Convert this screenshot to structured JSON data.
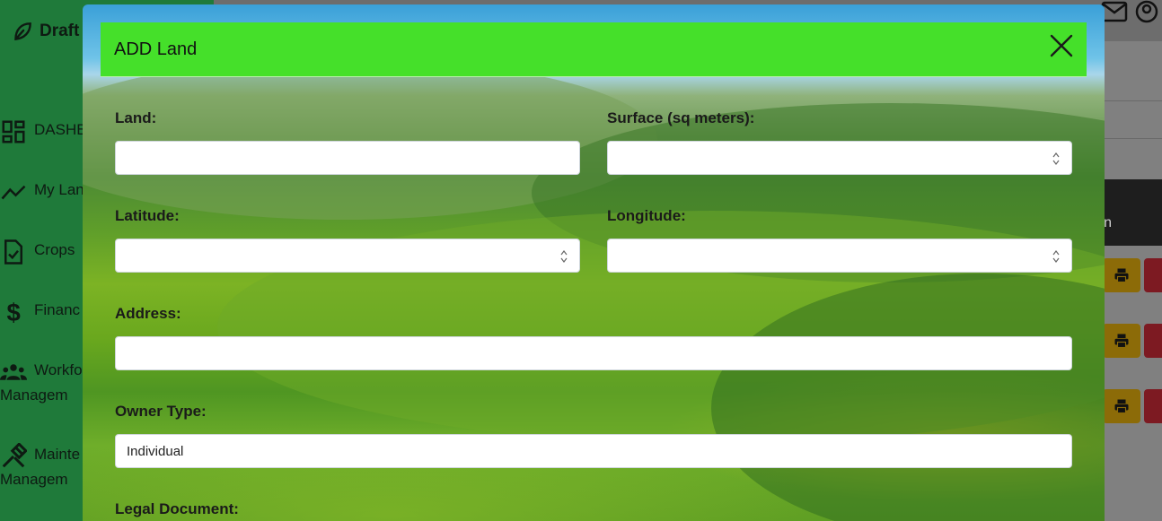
{
  "app": {
    "brand": "Draft",
    "nav": [
      {
        "label": "DASHB",
        "icon": "dashboard-icon"
      },
      {
        "label": "My Lan",
        "icon": "chart-line-icon"
      },
      {
        "label": "Crops",
        "icon": "file-check-icon"
      },
      {
        "label": "Financ",
        "icon": "dollar-icon"
      },
      {
        "label": "Workfo",
        "label2": "Managem",
        "icon": "users-icon"
      },
      {
        "label": "Mainte",
        "label2": "Managem",
        "icon": "tools-icon"
      }
    ],
    "table_header_partial": "n"
  },
  "modal": {
    "title": "ADD Land",
    "fields": {
      "land": {
        "label": "Land:",
        "value": ""
      },
      "surface": {
        "label": "Surface (sq meters):",
        "value": ""
      },
      "latitude": {
        "label": "Latitude:",
        "value": ""
      },
      "longitude": {
        "label": "Longitude:",
        "value": ""
      },
      "address": {
        "label": "Address:",
        "value": ""
      },
      "owner_type": {
        "label": "Owner Type:",
        "value": "Individual"
      },
      "legal_document": {
        "label": "Legal Document:"
      }
    }
  },
  "colors": {
    "header_green": "#45e02a",
    "sidebar_green": "#1f7a3a",
    "print_button": "#8c6b08",
    "delete_button": "#7d1a22"
  }
}
